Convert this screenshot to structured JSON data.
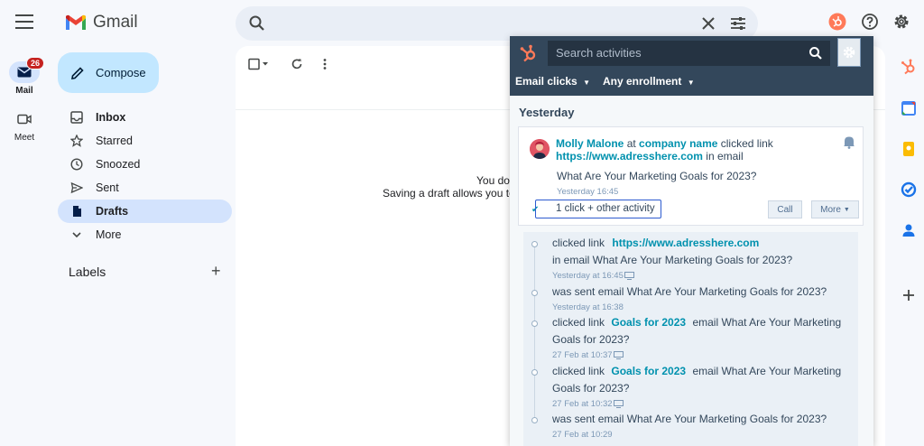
{
  "app": {
    "name": "Gmail"
  },
  "rail": {
    "items": [
      {
        "label": "Mail",
        "badge": "26"
      },
      {
        "label": "Meet"
      }
    ]
  },
  "compose": {
    "label": "Compose"
  },
  "nav": {
    "items": [
      {
        "label": "Inbox"
      },
      {
        "label": "Starred"
      },
      {
        "label": "Snoozed"
      },
      {
        "label": "Sent"
      },
      {
        "label": "Drafts"
      },
      {
        "label": "More"
      }
    ]
  },
  "labels": {
    "title": "Labels"
  },
  "main": {
    "empty_line1": "You do",
    "empty_line2": "Saving a draft allows you to"
  },
  "hubspot": {
    "search_placeholder": "Search activities",
    "filters": [
      "Email clicks",
      "Any enrollment"
    ],
    "day": "Yesterday",
    "card": {
      "contact": "Molly Malone",
      "at": "at",
      "company": "company name",
      "action": "clicked link",
      "url": "https://www.adresshere.com",
      "in_email": "in email",
      "subject": "What Are Your Marketing Goals for 2023?",
      "time": "Yesterday 16:45",
      "activity_button": "1 click + other activity",
      "call_button": "Call",
      "more_button": "More"
    },
    "timeline": [
      {
        "prefix": "clicked link",
        "link": "https://www.adresshere.com",
        "suffix": "",
        "line2": "in email What Are Your Marketing Goals for 2023?",
        "time": "Yesterday at 16:45",
        "device": true
      },
      {
        "prefix": "was sent email What Are Your Marketing Goals for 2023?",
        "link": "",
        "suffix": "",
        "line2": "",
        "time": "Yesterday at 16:38",
        "device": false
      },
      {
        "prefix": "clicked link",
        "link": "Goals for 2023",
        "suffix": "email What Are Your Marketing",
        "line2": "Goals for 2023?",
        "time": "27 Feb at 10:37",
        "device": true
      },
      {
        "prefix": "clicked link",
        "link": "Goals for 2023",
        "suffix": "email What Are Your Marketing",
        "line2": "Goals for 2023?",
        "time": "27 Feb at 10:32",
        "device": true
      },
      {
        "prefix": "was sent email What Are Your Marketing Goals for 2023?",
        "link": "",
        "suffix": "",
        "line2": "",
        "time": "27 Feb at 10:29",
        "device": false
      }
    ]
  },
  "colors": {
    "hubspot_orange": "#ff7a59",
    "hubspot_navy": "#33475b",
    "gmail_blue": "#c2e7ff",
    "link": "#0091ae"
  }
}
